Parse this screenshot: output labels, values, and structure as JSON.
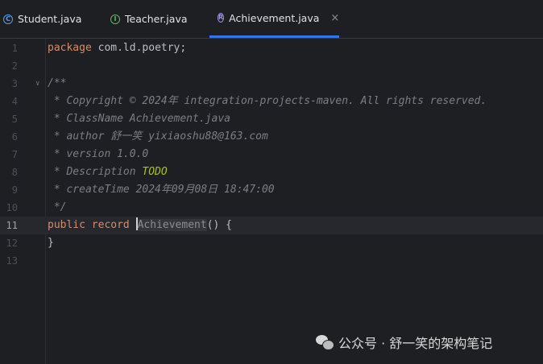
{
  "tabs": [
    {
      "label": "Student.java",
      "icon": "class-icon",
      "glyph": "C"
    },
    {
      "label": "Teacher.java",
      "icon": "interface-icon",
      "glyph": "I"
    },
    {
      "label": "Achievement.java",
      "icon": "record-icon",
      "glyph": "R",
      "active": true,
      "close": "×"
    }
  ],
  "editor": {
    "line_numbers": [
      "1",
      "2",
      "3",
      "4",
      "5",
      "6",
      "7",
      "8",
      "9",
      "10",
      "11",
      "12",
      "13"
    ],
    "lines": {
      "l1_kw": "package",
      "l1_rest": " com.ld.poetry;",
      "l3": "/**",
      "l4": " * Copyright © 2024年 integration-projects-maven. All rights reserved.",
      "l5": " * ClassName Achievement.java",
      "l6": " * author 舒一笑 yixiaoshu88@163.com",
      "l7": " * version 1.0.0",
      "l8_a": " * Description ",
      "l8_todo": "TODO",
      "l9": " * createTime 2024年09月08日 18:47:00",
      "l10": " */",
      "l11_kw1": "public",
      "l11_kw2": "record",
      "l11_name": "Achievement",
      "l11_rest": "() {",
      "l12": "}"
    }
  },
  "watermark": {
    "text": "公众号 · 舒一笑的架构笔记"
  }
}
